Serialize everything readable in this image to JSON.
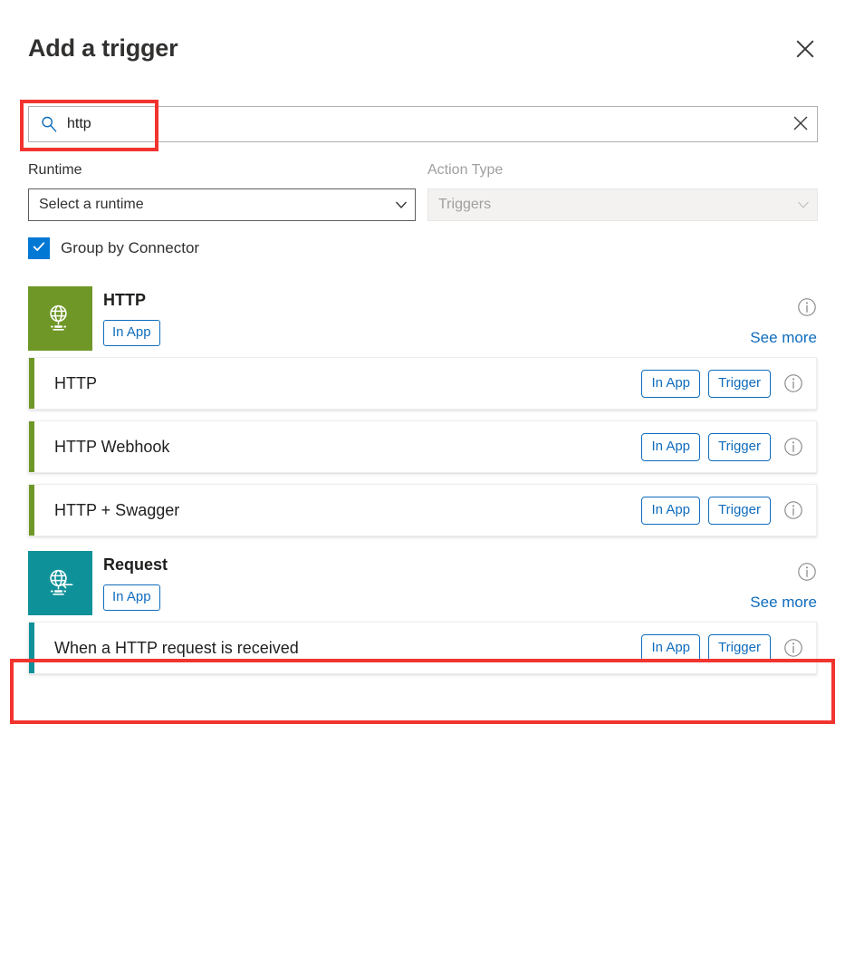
{
  "dialog": {
    "title": "Add a trigger",
    "close_icon": "close-icon"
  },
  "search": {
    "value": "http",
    "placeholder": "Search",
    "icon": "search-icon",
    "clear_icon": "clear-icon"
  },
  "filters": {
    "runtime": {
      "label": "Runtime",
      "value": "Select a runtime",
      "chevron_icon": "chevron-down-icon",
      "disabled": false
    },
    "action_type": {
      "label": "Action Type",
      "value": "Triggers",
      "chevron_icon": "chevron-down-icon",
      "disabled": true
    }
  },
  "group_by_connector": {
    "label": "Group by Connector",
    "checked": true,
    "check_icon": "checkmark-icon"
  },
  "colors": {
    "accent_blue": "#0f6cbd",
    "link_blue": "#0f6cbd",
    "checkbox_blue": "#0078d4",
    "http_green": "#6f9727",
    "request_teal": "#0f9199",
    "highlight_red": "#f2342f"
  },
  "connector_groups": [
    {
      "name": "HTTP",
      "icon": "globe-network-icon",
      "icon_color": "#6f9727",
      "badge": "In App",
      "info_icon": "info-icon",
      "see_more": "See more",
      "operations": [
        {
          "name": "HTTP",
          "badges": [
            "In App",
            "Trigger"
          ],
          "info_icon": "info-icon",
          "accent_color": "#6f9727",
          "highlighted": false
        },
        {
          "name": "HTTP Webhook",
          "badges": [
            "In App",
            "Trigger"
          ],
          "info_icon": "info-icon",
          "accent_color": "#6f9727",
          "highlighted": false
        },
        {
          "name": "HTTP + Swagger",
          "badges": [
            "In App",
            "Trigger"
          ],
          "info_icon": "info-icon",
          "accent_color": "#6f9727",
          "highlighted": false
        }
      ]
    },
    {
      "name": "Request",
      "icon": "globe-inbound-arrow-icon",
      "icon_color": "#0f9199",
      "badge": "In App",
      "info_icon": "info-icon",
      "see_more": "See more",
      "operations": [
        {
          "name": "When a HTTP request is received",
          "badges": [
            "In App",
            "Trigger"
          ],
          "info_icon": "info-icon",
          "accent_color": "#0f9199",
          "highlighted": true
        }
      ]
    }
  ]
}
